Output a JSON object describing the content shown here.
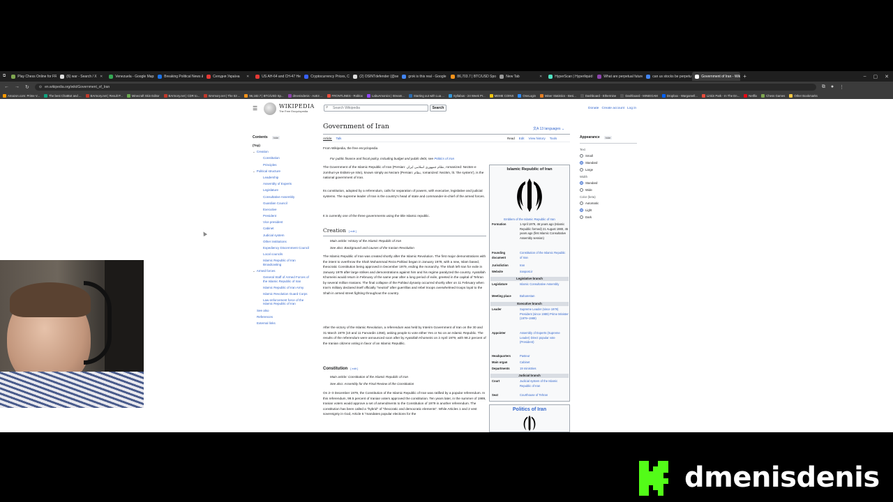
{
  "browser": {
    "tabs": [
      {
        "title": "Play Chess Online for FREE -",
        "color": "#7fa650"
      },
      {
        "title": "(6) war - Search / X",
        "color": "#dddddd"
      },
      {
        "title": "Venezuela - Google Maps",
        "color": "#34a853"
      },
      {
        "title": "Breaking Political News & Pr",
        "color": "#1a73e8"
      },
      {
        "title": "Сегодня Україна",
        "color": "#e53935"
      },
      {
        "title": "US AH-64 and CH-47 Helico",
        "color": "#e53935"
      },
      {
        "title": "Cryptocurrency Prices, Chart",
        "color": "#3861fb"
      },
      {
        "title": "(2) OSINTdefender (@sentd)",
        "color": "#dddddd"
      },
      {
        "title": "grok is this real - Google Se",
        "color": "#4285f4"
      },
      {
        "title": "86,703.7 | BTC/USD Spot Tra",
        "color": "#f7931a"
      },
      {
        "title": "New Tab",
        "color": "#999999"
      },
      {
        "title": "HyperScan | Hyperliquid Ex",
        "color": "#50e3c2"
      },
      {
        "title": "What are perpetual futures",
        "color": "#8e44ad"
      },
      {
        "title": "can us stocks be perpetual t",
        "color": "#4285f4"
      },
      {
        "title": "Government of Iran - Wikipe",
        "color": "#ffffff",
        "active": true
      }
    ],
    "url": "en.wikipedia.org/wiki/Government_of_Iran",
    "bookmarks": [
      "Amazon.com: Prime V...",
      "The best ChatBot and ...",
      "BArmory.net | Result P...",
      "Minecraft Skin Editor",
      "BArmory.net | CDR to...",
      "BArmory.net | The 53 ...",
      "96,182.7 | BTC/USD Sp...",
      "dmenisdenis - AoE4 ...",
      "FRONTLINES - Roblox",
      "LabuAmonics | Stream...",
      "Starting out with Lua ...",
      "Syllabus - 24 Week Pr...",
      "MEME COINS",
      "OneLogin",
      "Miner Statistics - Besi...",
      "Dashboard - Ethermine",
      "Dashboard - MINIEGAM",
      "Dropbox - Wargamell...",
      "Linkin Park - In The En...",
      "Netflix",
      "Chess Games",
      "Other Bookmarks"
    ]
  },
  "wiki": {
    "logo_word": "WIKIPEDIA",
    "logo_tag": "The Free Encyclopedia",
    "search_placeholder": "Search Wikipedia",
    "search_button": "Search",
    "top_links": [
      "Donate",
      "Create account",
      "Log in"
    ],
    "toc": {
      "title": "Contents",
      "hide": "hide",
      "items": [
        {
          "label": "(Top)",
          "cls": "top"
        },
        {
          "label": "Creation",
          "cls": "l1 ex"
        },
        {
          "label": "Constitution",
          "cls": "l2"
        },
        {
          "label": "Principles",
          "cls": "l2"
        },
        {
          "label": "Political structure",
          "cls": "l1 ex"
        },
        {
          "label": "Leadership",
          "cls": "l2"
        },
        {
          "label": "Assembly of Experts",
          "cls": "l2"
        },
        {
          "label": "Legislature",
          "cls": "l2"
        },
        {
          "label": "Consultative Assembly",
          "cls": "l2"
        },
        {
          "label": "Guardian Council",
          "cls": "l2"
        },
        {
          "label": "Executive",
          "cls": "l2"
        },
        {
          "label": "President",
          "cls": "l2"
        },
        {
          "label": "Vice president",
          "cls": "l2"
        },
        {
          "label": "Cabinet",
          "cls": "l2"
        },
        {
          "label": "Judicial system",
          "cls": "l2"
        },
        {
          "label": "Other institutions",
          "cls": "l2"
        },
        {
          "label": "Expediency Discernment Council",
          "cls": "l2"
        },
        {
          "label": "Local councils",
          "cls": "l2"
        },
        {
          "label": "Islamic Republic of Iran Broadcasting",
          "cls": "l2"
        },
        {
          "label": "Armed forces",
          "cls": "l1 ex"
        },
        {
          "label": "General Staff of Armed Forces of the Islamic Republic of Iran",
          "cls": "l2"
        },
        {
          "label": "Islamic Republic of Iran Army",
          "cls": "l2"
        },
        {
          "label": "Islamic Revolution Guard Corps",
          "cls": "l2"
        },
        {
          "label": "Law enforcement force of the Islamic Republic of Iran",
          "cls": "l2"
        },
        {
          "label": "See also",
          "cls": "l1"
        },
        {
          "label": "References",
          "cls": "l1"
        },
        {
          "label": "External links",
          "cls": "l1"
        }
      ]
    },
    "article": {
      "title": "Government of Iran",
      "languages": "13 languages",
      "tabs_left": [
        "Article",
        "Talk"
      ],
      "tabs_right": [
        "Read",
        "Edit",
        "View history",
        "Tools"
      ],
      "from": "From Wikipedia, the free encyclopedia",
      "hatnote_pre": "For public finance and fiscal policy, including budget and public debt, see ",
      "hatnote_link": "Politics of Iran",
      "p1": "The Government of the Islamic Republic of Iran (Persian: نظام جمهوری اسلامی ایران, romanized: Nezām-e Jomhuri-ye Eslāmi-ye Irān), known simply as Nezam (Persian: نظام, romanized: Nezām, lit. 'the system'), is the national government of Iran.",
      "p2": "Its constitution, adopted by a referendum, calls for separation of powers, with executive, legislative and judicial systems. The supreme leader of Iran is the country's head of state and commander-in-chief of the armed forces.",
      "p3": "It is currently one of the three governments using the title Islamic republic.",
      "creation_h": "Creation",
      "edit": "[ edit ]",
      "creation_main": "Main article: History of the Islamic Republic of Iran",
      "creation_see": "See also: Background and causes of the Iranian Revolution",
      "creation_p1": "The Islamic Republic of Iran was created shortly after the Islamic Revolution. The first major demonstrations with the intent to overthrow the Shah Mohammad Reza Pahlavi began in January 1978, with a new, Islam based, theocratic Constitution being approved in December 1979, ending the monarchy. The Shah left Iran for exile in January 1979 after large strikes and demonstrations against him and his regime paralyzed the country. Ayatollah Khomeini would return in February of the same year after a long period of exile, greeted in the capital of Tehran by several million Iranians. The final collapse of the Pahlavi dynasty occurred shortly after on 11 February when Iran's military declared itself officially \"neutral\" after guerrillas and rebel troops overwhelmed troops loyal to the Shah in armed street fighting throughout the country.",
      "creation_p2": "After the victory of the Islamic Revolution, a referendum was held by Interim Government of Iran on the 30 and 31 March 1979 (10 and 11 Farvardin 1358), asking people to vote either Yes or No on an Islamic Republic. The results of the referendum were announced soon after by Ayatollah Khomeini on 2 April 1979, with 98.2 percent of the Iranian citizens voting in favor of an Islamic Republic.",
      "constitution_h": "Constitution",
      "const_main": "Main article: Constitution of the Islamic Republic of Iran",
      "const_see": "See also: Assembly for the Final Review of the Constitution",
      "const_p1": "On 2–3 December 1979, the Constitution of the Islamic Republic of Iran was ratified by a popular referendum. In this referendum, 99.5 percent of Iranian voters approved the constitution. Ten years later, in the summer of 1989, Iranian voters would approve a set of amendments to the Constitution of 1979 in another referendum. The constitution has been called a \"hybrid\" of \"theocratic and democratic elements\". While Articles 1 and 2 vest sovereignty in God, Article 6 \"mandates popular elections for the"
    },
    "infobox": {
      "title": "Islamic Republic of Iran",
      "caption": "Emblem of the Islamic Republic of Iran",
      "formation_k": "Formation",
      "formation_v": "1 April 1979, 46 years ago (Islamic Republic formed) 21 August 1980, 45 years ago (first Islamic Consultative Assembly session)",
      "founding_k": "Founding document",
      "founding_v": "Constitution of the Islamic Republic of Iran",
      "juris_k": "Jurisdiction",
      "juris_v": "Iran",
      "web_k": "Website",
      "web_v": "iranpost.ir",
      "leg_sec": "Legislative branch",
      "legis_k": "Legislature",
      "legis_v": "Islamic Consultative Assembly",
      "meet_k": "Meeting place",
      "meet_v": "Baharestan",
      "exec_sec": "Executive branch",
      "leader_k": "Leader",
      "leader_v": "Supreme Leader (since 1979) President (since 1989) Prime Minister (1979–1989)",
      "appointer_k": "Appointer",
      "appointer_v": "Assembly of Experts (Supreme Leader) Direct popular vote (President)",
      "hq_k": "Headquarters",
      "hq_v": "Pasteur",
      "organ_k": "Main organ",
      "organ_v": "Cabinet",
      "dept_k": "Departments",
      "dept_v": "19 ministries",
      "jud_sec": "Judicial branch",
      "court_k": "Court",
      "court_v": "Judicial system of the Islamic Republic of Iran",
      "seat_k": "Seat",
      "seat_v": "Courthouse of Tehran",
      "politics_title": "Politics of Iran"
    },
    "appearance": {
      "title": "Appearance",
      "hide": "hide",
      "text_label": "Text",
      "text_opts": [
        "Small",
        "Standard",
        "Large"
      ],
      "width_label": "Width",
      "width_opts": [
        "Standard",
        "Wide"
      ],
      "color_label": "Color (beta)",
      "color_opts": [
        "Automatic",
        "Light",
        "Dark"
      ]
    }
  },
  "streamer": {
    "name": "dmenisdenis",
    "logo_color": "#53fc18"
  }
}
